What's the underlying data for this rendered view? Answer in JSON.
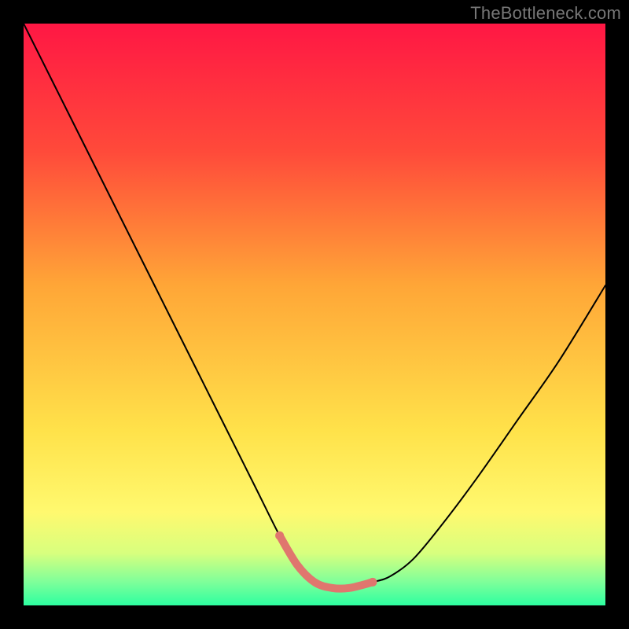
{
  "watermark": "TheBottleneck.com",
  "chart_data": {
    "type": "line",
    "title": "",
    "xlabel": "",
    "ylabel": "",
    "xlim": [
      0,
      100
    ],
    "ylim": [
      0,
      100
    ],
    "background_gradient": {
      "stops": [
        {
          "pos": 0.0,
          "color": "#ff1744"
        },
        {
          "pos": 0.22,
          "color": "#ff4a3a"
        },
        {
          "pos": 0.45,
          "color": "#ffa637"
        },
        {
          "pos": 0.7,
          "color": "#ffe24a"
        },
        {
          "pos": 0.84,
          "color": "#fff96f"
        },
        {
          "pos": 0.91,
          "color": "#d8ff7e"
        },
        {
          "pos": 0.96,
          "color": "#7eff9a"
        },
        {
          "pos": 1.0,
          "color": "#2dffa0"
        }
      ]
    },
    "series": [
      {
        "name": "bottleneck-curve",
        "color": "#000000",
        "width": 2,
        "x": [
          0,
          5,
          10,
          15,
          20,
          25,
          30,
          35,
          40,
          44,
          47,
          50,
          53,
          56,
          60,
          63,
          67,
          72,
          78,
          85,
          92,
          100
        ],
        "y": [
          100,
          90,
          80,
          70,
          60,
          50,
          40,
          30,
          20,
          12,
          7,
          4,
          3,
          3,
          4,
          5,
          8,
          14,
          22,
          32,
          42,
          55
        ]
      },
      {
        "name": "highlight-band",
        "color": "#e0766e",
        "width": 10,
        "highlight": true,
        "x": [
          44,
          47,
          50,
          53,
          56,
          60
        ],
        "y": [
          12,
          7,
          4,
          3,
          3,
          4
        ]
      }
    ]
  }
}
